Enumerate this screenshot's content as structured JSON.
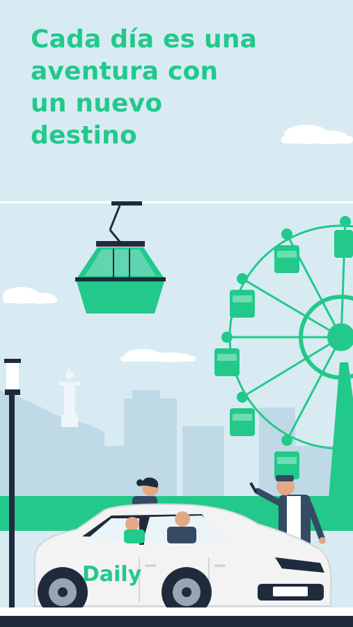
{
  "headline": {
    "lines": [
      "Cada día es una",
      "aventura con",
      "un nuevo",
      "destino"
    ]
  },
  "brand": {
    "car_logo_text": "Daily"
  },
  "colors": {
    "background": "#d8ebf3",
    "accent_green": "#22c98a",
    "skyline": "#bcd7e4",
    "car_body": "#f3f3f3",
    "dark_ink": "#1f2b3c"
  },
  "icons": [
    "cable-car-icon",
    "ferris-wheel-icon",
    "car-icon",
    "street-lamp-icon",
    "statue-icon"
  ]
}
